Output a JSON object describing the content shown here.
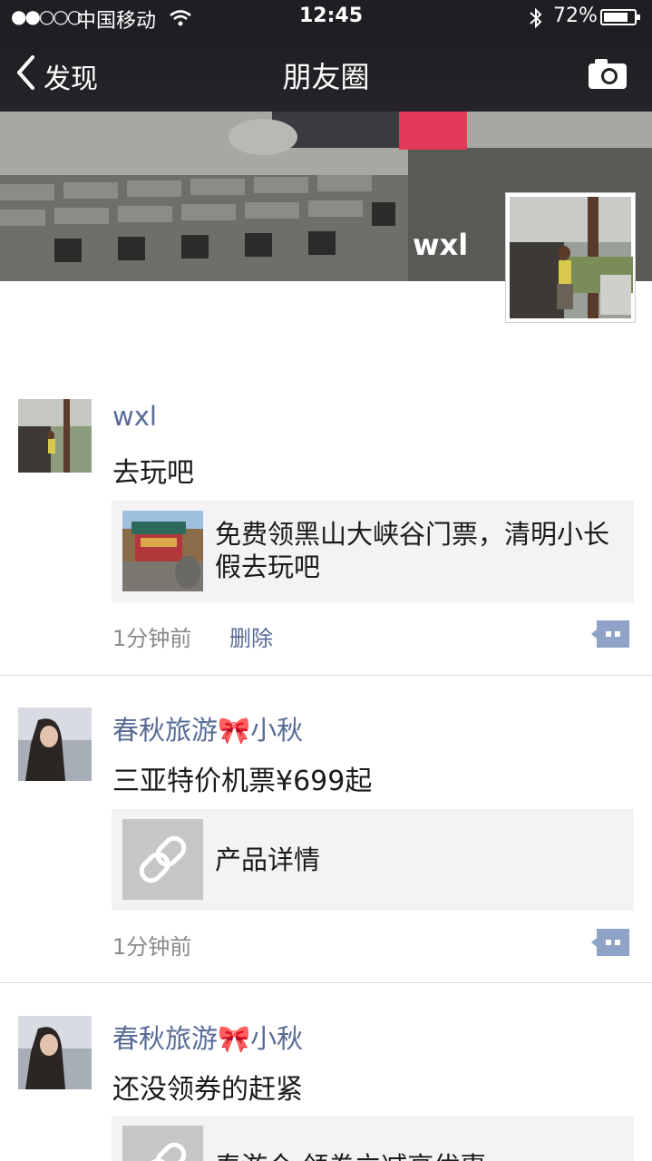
{
  "status_bar": {
    "signal": "●●○○○",
    "carrier": "中国移动",
    "time": "12:45",
    "battery": "72%",
    "icons": [
      "wifi-icon",
      "bluetooth-icon",
      "battery-icon"
    ]
  },
  "nav": {
    "back_label": "发现",
    "title": "朋友圈",
    "camera_icon": "camera-icon"
  },
  "profile": {
    "name": "wxl"
  },
  "posts": [
    {
      "name": "wxl",
      "text": "去玩吧",
      "link": {
        "title": "免费领黑山大峡谷门票，清明小长假去玩吧"
      },
      "time": "1分钟前",
      "delete_label": "删除"
    },
    {
      "name": "春秋旅游🎀小秋",
      "text": "三亚特价机票¥699起",
      "link": {
        "title": "产品详情",
        "thumb_icon": "link-icon"
      },
      "time": "1分钟前"
    },
    {
      "name": "春秋旅游🎀小秋",
      "text": "还没领券的赶紧",
      "link": {
        "title": "春游仓 领券立减高优惠",
        "thumb_icon": "link-icon"
      }
    }
  ],
  "colors": {
    "nav_background": "#1f1e23",
    "name_color": "#576b95",
    "card_background": "#f3f3f5",
    "comment_button": "#8fa2c8"
  }
}
